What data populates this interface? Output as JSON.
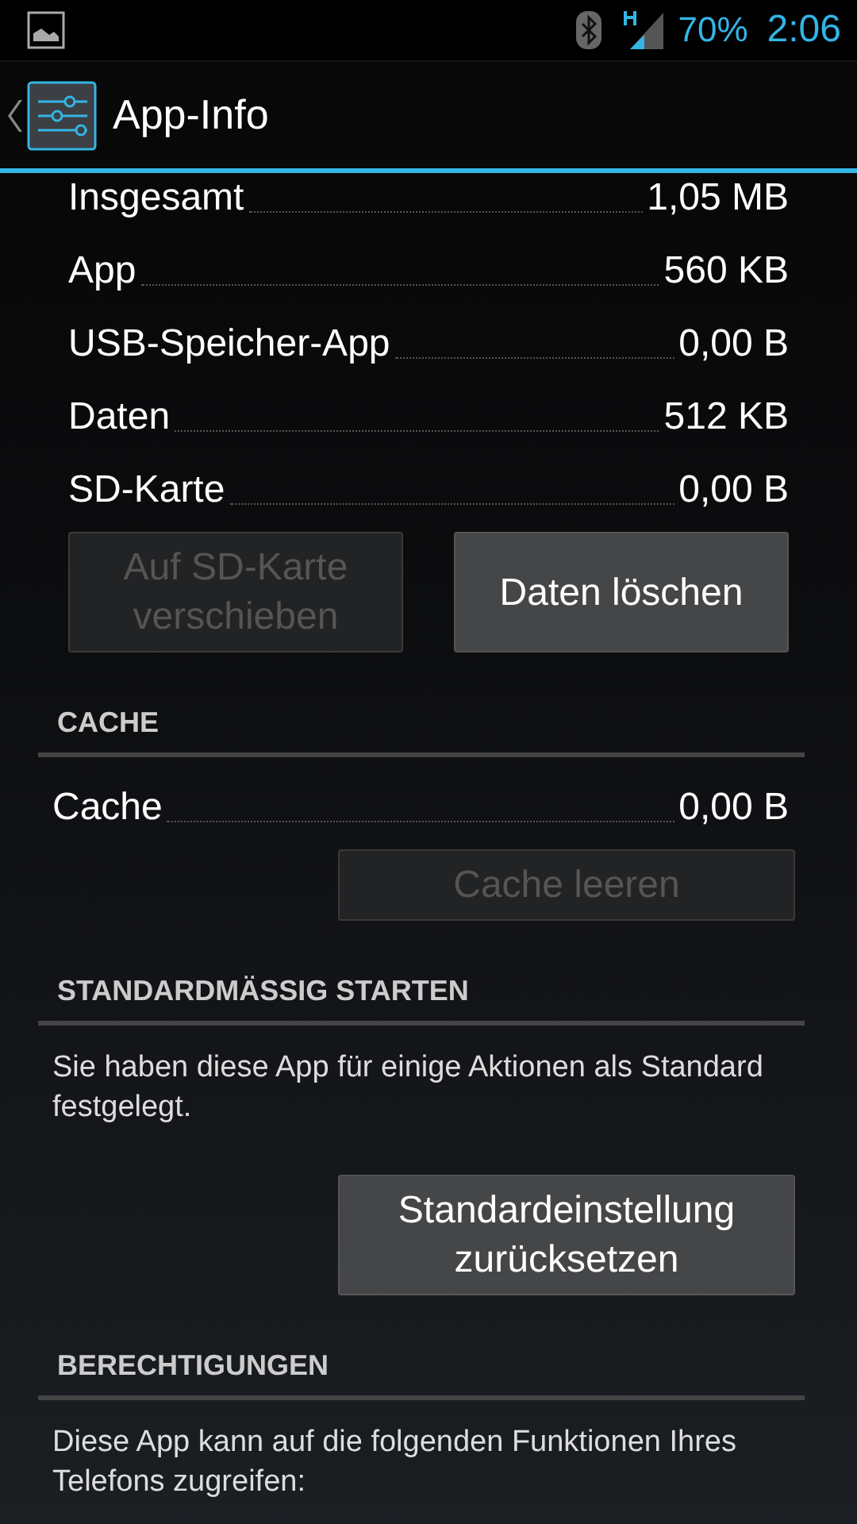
{
  "status_bar": {
    "battery_percent": "70%",
    "time": "2:06"
  },
  "action_bar": {
    "title": "App-Info"
  },
  "storage": {
    "rows": [
      {
        "label": "Insgesamt",
        "value": "1,05 MB"
      },
      {
        "label": "App",
        "value": "560 KB"
      },
      {
        "label": "USB-Speicher-App",
        "value": "0,00 B"
      },
      {
        "label": "Daten",
        "value": "512 KB"
      },
      {
        "label": "SD-Karte",
        "value": "0,00 B"
      }
    ],
    "buttons": [
      {
        "label": "Auf SD-Karte verschieben",
        "disabled": true
      },
      {
        "label": "Daten löschen",
        "disabled": false
      }
    ]
  },
  "cache": {
    "header": "CACHE",
    "rows": [
      {
        "label": "Cache",
        "value": "0,00 B"
      }
    ],
    "button": {
      "label": "Cache leeren",
      "disabled": true
    }
  },
  "launch_default": {
    "header": "STANDARDMÄSSIG STARTEN",
    "text": "Sie haben diese App für einige Aktionen als Standard festgelegt.",
    "button": {
      "label": "Standardeinstellung zurücksetzen",
      "disabled": false
    }
  },
  "permissions": {
    "header": "BERECHTIGUNGEN",
    "text": "Diese App kann auf die folgenden Funktionen Ihres Telefons zugreifen:"
  }
}
